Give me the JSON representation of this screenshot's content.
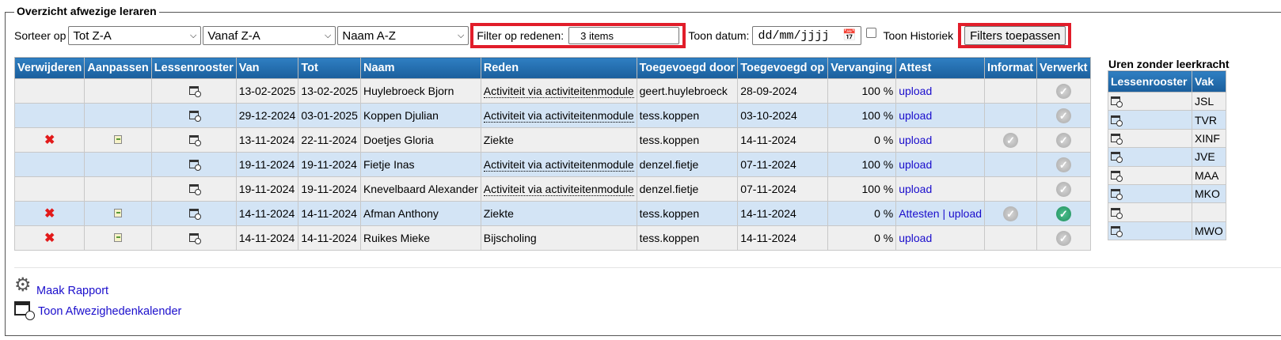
{
  "legend": "Overzicht afwezige leraren",
  "toolbar": {
    "sort_label": "Sorteer op",
    "sort1": "Tot Z-A",
    "sort2": "Vanaf Z-A",
    "sort3": "Naam A-Z",
    "filter_label": "Filter op redenen:",
    "filter_value": "3 items",
    "date_label": "Toon datum:",
    "date_placeholder": "dd/mm/jjjj",
    "history_label": "Toon Historiek",
    "apply_label": "Filters toepassen"
  },
  "table": {
    "headers": [
      "Verwijderen",
      "Aanpassen",
      "Lessenrooster",
      "Van",
      "Tot",
      "Naam",
      "Reden",
      "Toegevoegd door",
      "Toegevoegd op",
      "Vervanging",
      "Attest",
      "Informat",
      "Verwerkt"
    ],
    "rows": [
      {
        "van": "13-02-2025",
        "tot": "13-02-2025",
        "naam": "Huylebroeck Bjorn",
        "reden": "Activiteit via activiteitenmodule",
        "door": "geert.huylebroeck",
        "op": "28-09-2024",
        "verv": "100 %",
        "attest": "upload"
      },
      {
        "van": "29-12-2024",
        "tot": "03-01-2025",
        "naam": "Koppen Djulian",
        "reden": "Activiteit via activiteitenmodule",
        "door": "tess.koppen",
        "op": "03-10-2024",
        "verv": "100 %",
        "attest": "upload"
      },
      {
        "van": "13-11-2024",
        "tot": "22-11-2024",
        "naam": "Doetjes Gloria",
        "reden": "Ziekte",
        "door": "tess.koppen",
        "op": "14-11-2024",
        "verv": "0 %",
        "attest": "upload"
      },
      {
        "van": "19-11-2024",
        "tot": "19-11-2024",
        "naam": "Fietje Inas",
        "reden": "Activiteit via activiteitenmodule",
        "door": "denzel.fietje",
        "op": "07-11-2024",
        "verv": "100 %",
        "attest": "upload"
      },
      {
        "van": "19-11-2024",
        "tot": "19-11-2024",
        "naam": "Knevelbaard Alexander",
        "reden": "Activiteit via activiteitenmodule",
        "door": "denzel.fietje",
        "op": "07-11-2024",
        "verv": "100 %",
        "attest": "upload"
      },
      {
        "van": "14-11-2024",
        "tot": "14-11-2024",
        "naam": "Afman Anthony",
        "reden": "Ziekte",
        "door": "tess.koppen",
        "op": "14-11-2024",
        "verv": "0 %",
        "attest_a": "Attesten",
        "attest_sep": "|",
        "attest": "upload"
      },
      {
        "van": "14-11-2024",
        "tot": "14-11-2024",
        "naam": "Ruikes Mieke",
        "reden": "Bijscholing",
        "door": "tess.koppen",
        "op": "14-11-2024",
        "verv": "0 %",
        "attest": "upload"
      }
    ]
  },
  "side": {
    "title": "Uren zonder leerkracht",
    "headers": [
      "Lessenrooster",
      "Vak"
    ],
    "vakken": [
      "JSL",
      "TVR",
      "XINF",
      "JVE",
      "MAA",
      "MKO",
      "",
      "MWO"
    ]
  },
  "links": {
    "report": "Maak Rapport",
    "calendar": "Toon Afwezighedenkalender"
  },
  "icons": [
    "delete-icon",
    "edit-icon",
    "schedule-icon",
    "check-icon",
    "gear-icon",
    "calendar-icon"
  ],
  "colors": {
    "header_blue": "#1a5e9c",
    "row_even": "#d3e4f5",
    "row_odd": "#efefef",
    "highlight_red": "#e11d2a",
    "delete_red": "#e21a1a",
    "check_green": "#1f8f5c",
    "link": "#1a0dcc"
  }
}
